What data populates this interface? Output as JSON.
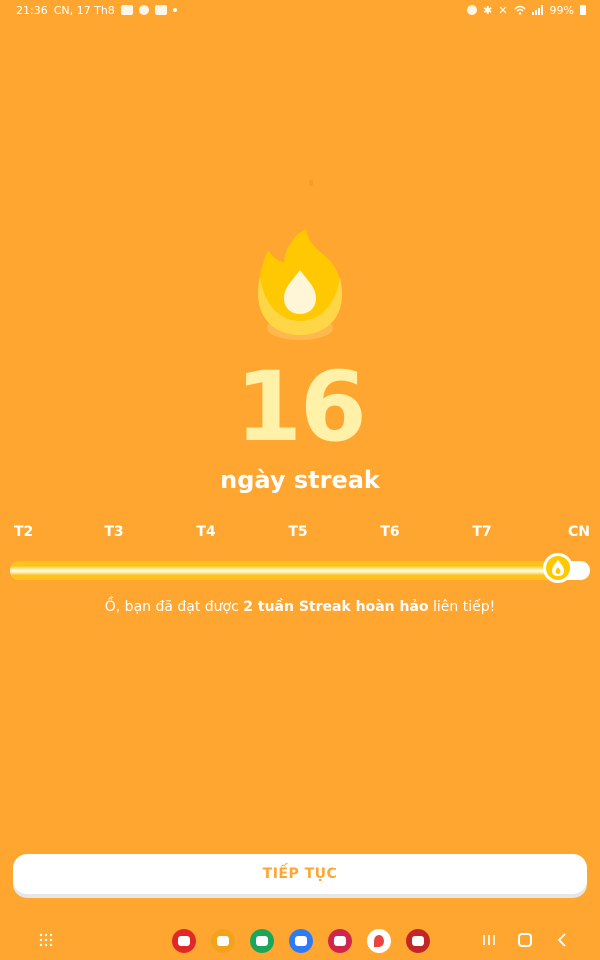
{
  "status_bar": {
    "time": "21:36",
    "date": "CN, 17 Th8",
    "battery": "99%"
  },
  "streak": {
    "count": "16",
    "label": "ngày streak"
  },
  "week": {
    "days": [
      "T2",
      "T3",
      "T4",
      "T5",
      "T6",
      "T7",
      "CN"
    ],
    "progress_fraction": 0.95
  },
  "message": {
    "prefix": "Ồ, bạn đã đạt được ",
    "highlight": "2 tuần Streak hoàn hảo",
    "suffix": " liên tiếp!"
  },
  "continue_button": {
    "label": "TIẾP TỤC"
  },
  "colors": {
    "background": "#FFA630",
    "flame": "#FFC800",
    "number": "#FFF1A8"
  },
  "dock": {
    "apps": [
      {
        "icon": "flipboard-icon",
        "color": "#E12828"
      },
      {
        "icon": "folder-icon",
        "color": "#F2A21B"
      },
      {
        "icon": "phone-icon",
        "color": "#1CA65B"
      },
      {
        "icon": "messages-icon",
        "color": "#2F7BF5"
      },
      {
        "icon": "camera-icon",
        "color": "#D0264A"
      },
      {
        "icon": "maps-icon",
        "color": "#FFFFFF"
      },
      {
        "icon": "app-icon",
        "color": "#C32626"
      }
    ]
  }
}
